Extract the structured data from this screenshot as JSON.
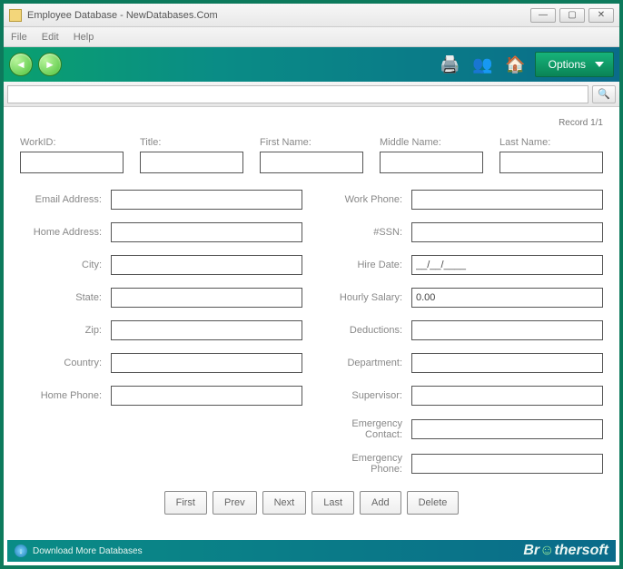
{
  "window": {
    "title": "Employee Database - NewDatabases.Com"
  },
  "menu": {
    "file": "File",
    "edit": "Edit",
    "help": "Help"
  },
  "toolbar": {
    "options": "Options"
  },
  "search": {
    "value": ""
  },
  "status": {
    "record": "Record 1/1"
  },
  "fields": {
    "workid": {
      "label": "WorkID:",
      "value": ""
    },
    "title": {
      "label": "Title:",
      "value": ""
    },
    "firstname": {
      "label": "First Name:",
      "value": ""
    },
    "middlename": {
      "label": "Middle Name:",
      "value": ""
    },
    "lastname": {
      "label": "Last Name:",
      "value": ""
    },
    "email": {
      "label": "Email Address:",
      "value": ""
    },
    "homeaddr": {
      "label": "Home Address:",
      "value": ""
    },
    "city": {
      "label": "City:",
      "value": ""
    },
    "state": {
      "label": "State:",
      "value": ""
    },
    "zip": {
      "label": "Zip:",
      "value": ""
    },
    "country": {
      "label": "Country:",
      "value": ""
    },
    "homephone": {
      "label": "Home Phone:",
      "value": ""
    },
    "workphone": {
      "label": "Work Phone:",
      "value": ""
    },
    "ssn": {
      "label": "#SSN:",
      "value": ""
    },
    "hiredate": {
      "label": "Hire Date:",
      "value": "__/__/____"
    },
    "salary": {
      "label": "Hourly Salary:",
      "value": "0.00"
    },
    "deductions": {
      "label": "Deductions:",
      "value": ""
    },
    "department": {
      "label": "Department:",
      "value": ""
    },
    "supervisor": {
      "label": "Supervisor:",
      "value": ""
    },
    "emcontact": {
      "label": "Emergency Contact:",
      "value": ""
    },
    "emphone": {
      "label": "Emergency Phone:",
      "value": ""
    }
  },
  "nav": {
    "first": "First",
    "prev": "Prev",
    "next": "Next",
    "last": "Last",
    "add": "Add",
    "delete": "Delete"
  },
  "footer": {
    "download": "Download More Databases",
    "brand": "Brothersoft"
  }
}
